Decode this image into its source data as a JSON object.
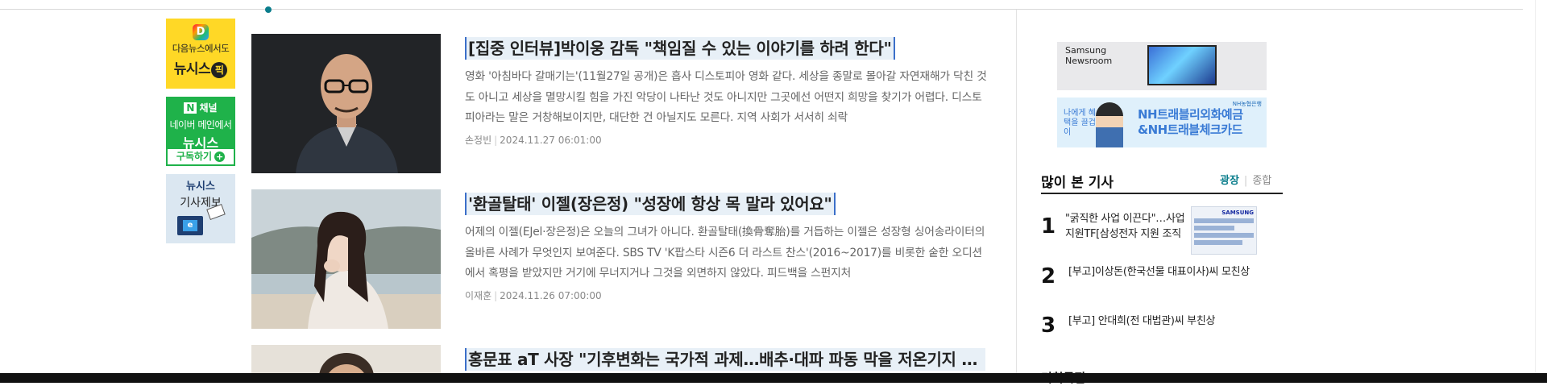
{
  "banners": {
    "daum": {
      "logo": "D",
      "line1": "다음뉴스에서도",
      "brand": "뉴시스",
      "pick": "픽"
    },
    "naver": {
      "n": "N",
      "head": "채널",
      "line1": "네이버 메인에서",
      "brand": "뉴시스",
      "subscribe": "구독하기",
      "plus": "+"
    },
    "report": {
      "brand": "뉴시스",
      "line2": "기사제보",
      "pc": "e"
    }
  },
  "articles": [
    {
      "title": "[집중 인터뷰]박이웅 감독 \"책임질 수 있는 이야기를 하려 한다\"",
      "summary": "영화 '아침바다 갈매기는'(11월27일 공개)은 흡사 디스토피아 영화 같다. 세상을 종말로 몰아갈 자연재해가 닥친 것도 아니고 세상을 멸망시킬 힘을 가진 악당이 나타난 것도 아니지만 그곳에선 어떤지 희망을 찾기가 어렵다. 디스토피아라는 말은 거창해보이지만, 대단한 건 아닐지도 모른다. 지역 사회가 서서히 쇠락",
      "author": "손정빈",
      "date": "2024.11.27 06:01:00"
    },
    {
      "title": "'환골탈태' 이젤(장은정) \"성장에 항상 목 말라 있어요\"",
      "summary": "어제의 이젤(EJel·장은정)은 오늘의 그녀가 아니다. 환골탈태(換骨奪胎)를 거듭하는 이젤은 성장형 싱어송라이터의 올바른 사례가 무엇인지 보여준다. SBS TV 'K팝스타 시즌6 더 라스트 찬스'(2016~2017)를 비롯한 숱한 오디션에서 혹평을 받았지만 거기에 무너지거나 그것을 외면하지 않았다. 피드백을 스펀지처",
      "author": "이재훈",
      "date": "2024.11.26 07:00:00"
    },
    {
      "title": "홍문표 aT 사장 \"기후변화는 국가적 과제…배추·대파 파동 막을 저온기지 …",
      "summary": "",
      "author": "",
      "date": ""
    }
  ],
  "ads": {
    "samsung": {
      "text": "Samsung Newsroom"
    },
    "nh": {
      "small": "나에게 혜택을 끌겁이",
      "big1": "NH트래블리외화예금",
      "big2": "&NH트래블체크카드",
      "logo": "NH농협은행"
    }
  },
  "most_viewed": {
    "title": "많이 본 기사",
    "tab_active": "광장",
    "tab_inactive": "종합",
    "items": [
      {
        "num": "1",
        "text": "\"굵직한 사업 이끈다\"…사업지원TF[삼성전자 지원 조직",
        "thumb_brand": "SAMSUNG"
      },
      {
        "num": "2",
        "text": "[부고]이상돈(한국선물 대표이사)씨 모친상"
      },
      {
        "num": "3",
        "text": "[부고] 안대희(전 대법관)씨 부친상"
      }
    ]
  },
  "next_section": "기획특집",
  "colors": {
    "accent": "#0a7d8c",
    "title_highlight": "#e8f0f7",
    "title_border": "#3b6fc9"
  }
}
